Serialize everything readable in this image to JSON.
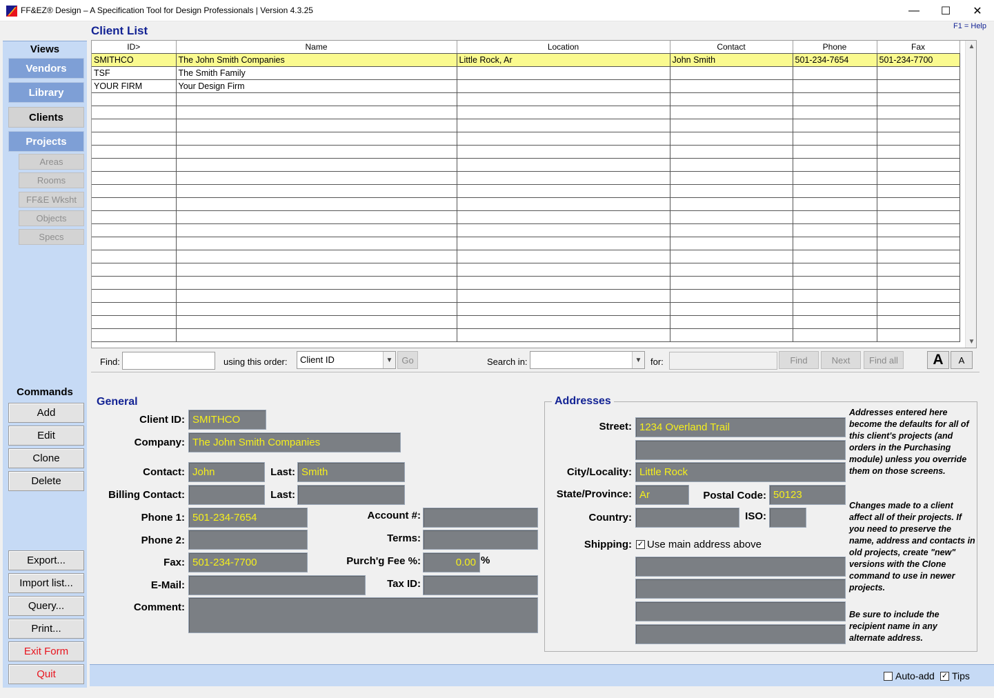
{
  "window": {
    "title": "FF&EZ® Design – A Specification Tool for Design Professionals | Version 4.3.25",
    "minimize_glyph": "—",
    "maximize_glyph": "☐",
    "close_glyph": "✕"
  },
  "form": {
    "title": "Client List",
    "help_hint": "F1 = Help"
  },
  "nav": {
    "views_heading": "Views",
    "views": [
      {
        "label": "Vendors"
      },
      {
        "label": "Library"
      },
      {
        "label": "Clients"
      },
      {
        "label": "Projects"
      }
    ],
    "subviews": [
      {
        "label": "Areas"
      },
      {
        "label": "Rooms"
      },
      {
        "label": "FF&E Wksht"
      },
      {
        "label": "Objects"
      },
      {
        "label": "Specs"
      }
    ],
    "commands_heading": "Commands",
    "commands": [
      {
        "label": "Add"
      },
      {
        "label": "Edit"
      },
      {
        "label": "Clone"
      },
      {
        "label": "Delete"
      }
    ],
    "bottom_commands": [
      {
        "label": "Export..."
      },
      {
        "label": "Import list..."
      },
      {
        "label": "Query..."
      },
      {
        "label": "Print..."
      },
      {
        "label": "Exit Form"
      },
      {
        "label": "Quit"
      }
    ]
  },
  "grid": {
    "columns": [
      "ID>",
      "Name",
      "Location",
      "Contact",
      "Phone",
      "Fax"
    ],
    "rows": [
      {
        "id": "SMITHCO",
        "name": "The John Smith Companies",
        "location": "Little Rock, Ar",
        "contact": "John Smith",
        "phone": "501-234-7654",
        "fax": "501-234-7700",
        "selected": true
      },
      {
        "id": "TSF",
        "name": "The Smith Family",
        "location": "",
        "contact": "",
        "phone": "",
        "fax": "",
        "selected": false
      },
      {
        "id": "YOUR FIRM",
        "name": "Your Design Firm",
        "location": "",
        "contact": "",
        "phone": "",
        "fax": "",
        "selected": false
      }
    ],
    "scroll_up": "▲",
    "scroll_down": "▼"
  },
  "findbar": {
    "find_label": "Find:",
    "find_value": "",
    "order_label": "using this order:",
    "order_value": "Client ID",
    "go_label": "Go",
    "search_in_label": "Search in:",
    "search_in_value": "",
    "for_label": "for:",
    "for_value": "",
    "find_btn": "Find",
    "next_btn": "Next",
    "find_all_btn": "Find all",
    "font_larger": "A",
    "font_smaller": "A",
    "dropdown_arrow": "▼"
  },
  "general": {
    "heading": "General",
    "client_id_label": "Client ID:",
    "client_id": "SMITHCO",
    "company_label": "Company:",
    "company": "The John Smith Companies",
    "contact_label": "Contact:",
    "contact_first": "John",
    "last_label": "Last:",
    "contact_last": "Smith",
    "billing_label": "Billing Contact:",
    "billing_first": "",
    "billing_last": "",
    "phone1_label": "Phone 1:",
    "phone1": "501-234-7654",
    "phone2_label": "Phone 2:",
    "phone2": "",
    "fax_label": "Fax:",
    "fax": "501-234-7700",
    "email_label": "E-Mail:",
    "email": "",
    "comment_label": "Comment:",
    "comment": "",
    "account_label": "Account #:",
    "account": "",
    "terms_label": "Terms:",
    "terms": "",
    "purch_fee_label": "Purch'g Fee %:",
    "purch_fee": "0.00",
    "percent_sign": "%",
    "tax_id_label": "Tax ID:",
    "tax_id": ""
  },
  "addresses": {
    "heading": "Addresses",
    "street_label": "Street:",
    "street1": "1234 Overland Trail",
    "street2": "",
    "city_label": "City/Locality:",
    "city": "Little Rock",
    "state_label": "State/Province:",
    "state": "Ar",
    "postal_label": "Postal Code:",
    "postal": "50123",
    "country_label": "Country:",
    "country": "",
    "iso_label": "ISO:",
    "iso": "",
    "shipping_label": "Shipping:",
    "use_main_label": "Use main address above",
    "use_main_checked": true,
    "ship_lines": [
      "",
      "",
      "",
      ""
    ],
    "note1": "Addresses entered here become the defaults for all of this client's projects (and orders in the Purchasing module) unless you override them on those screens.",
    "note2": "Changes made to a client affect all of their projects. If you need to preserve the name, address and contacts in old projects, create \"new\" versions with the Clone command to use in newer projects.",
    "note3": "Be sure to include the recipient name in any alternate address."
  },
  "status": {
    "auto_add_label": "Auto-add",
    "auto_add_checked": false,
    "tips_label": "Tips",
    "tips_checked": true
  },
  "colors": {
    "accent_blue": "#132394",
    "nav_bg": "#c6daf5",
    "nav_button": "#7e9fd6",
    "field_bg": "#7b7f84",
    "field_text": "#f5ef1c",
    "selected_row": "#fafa8f",
    "danger_text": "#e8141e"
  }
}
